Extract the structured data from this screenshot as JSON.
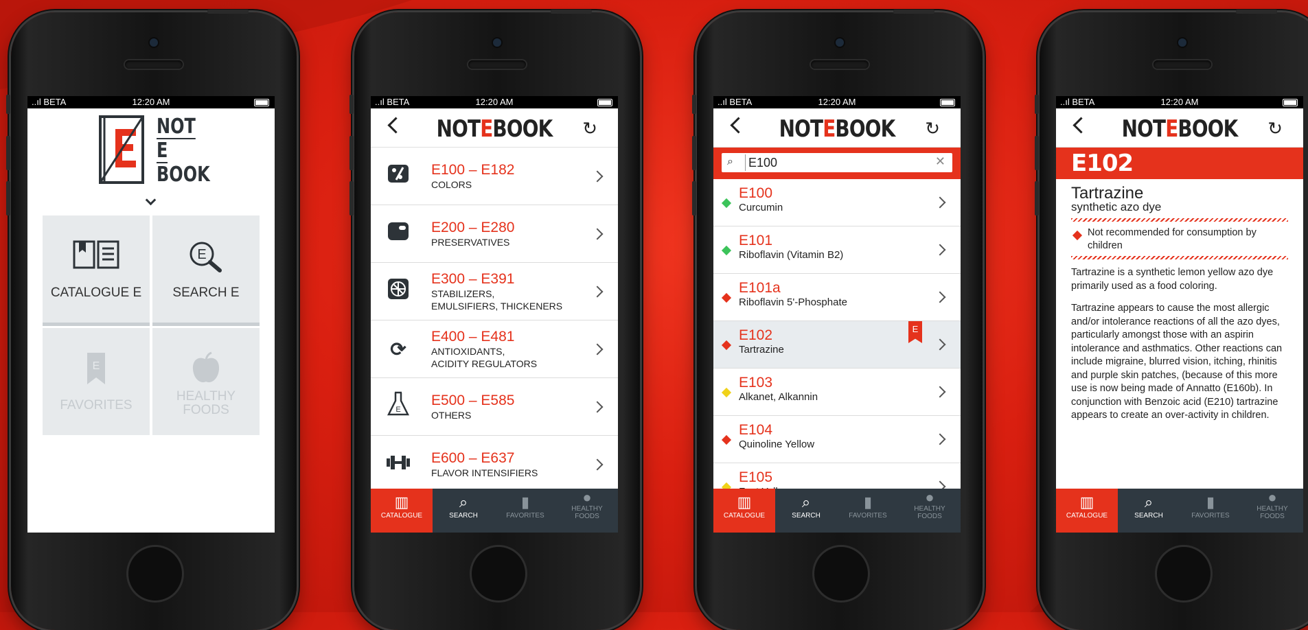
{
  "colors": {
    "accent": "#e5321c",
    "tabbar": "#2f3941",
    "safe": "#3cc35a",
    "caution": "#f0d21a",
    "danger": "#e5321c"
  },
  "status": {
    "signal": "..ıl BETA",
    "time": "12:20 AM"
  },
  "home": {
    "logo": {
      "line1": "NOT",
      "line2": "E",
      "line3": "BOOK",
      "letter": "E"
    },
    "tiles": [
      {
        "label": "CATALOGUE E",
        "icon": "catalogue-book-icon",
        "enabled": true
      },
      {
        "label": "SEARCH E",
        "icon": "search-e-icon",
        "enabled": true
      },
      {
        "label": "FAVORITES",
        "icon": "bookmark-icon",
        "enabled": false
      },
      {
        "label": "HEALTHY\nFOODS",
        "icon": "apple-icon",
        "enabled": false
      }
    ]
  },
  "navbar": {
    "title_pre": "NOT",
    "title_e": "E",
    "title_post": "BOOK",
    "back_icon": "chevron-left-icon",
    "refresh_icon": "refresh-icon"
  },
  "catalogue": {
    "rows": [
      {
        "range": "E100 – E182",
        "label": "COLORS",
        "icon": "palette-icon"
      },
      {
        "range": "E200 – E280",
        "label": "PRESERVATIVES",
        "icon": "can-icon"
      },
      {
        "range": "E300 – E391",
        "label": "STABILIZERS,\nEMULSIFIERS, THICKENERS",
        "icon": "fan-icon"
      },
      {
        "range": "E400 – E481",
        "label": "ANTIOXIDANTS,\nACIDITY REGULATORS",
        "icon": "cycle-icon"
      },
      {
        "range": "E500 – E585",
        "label": "OTHERS",
        "icon": "flask-icon"
      },
      {
        "range": "E600 – E637",
        "label": "FLAVOR INTENSIFIERS",
        "icon": "dumbbell-icon"
      }
    ]
  },
  "search": {
    "query": "E100",
    "results": [
      {
        "code": "E100",
        "name": "Curcumin",
        "status": "safe"
      },
      {
        "code": "E101",
        "name": "Riboflavin (Vitamin B2)",
        "status": "safe"
      },
      {
        "code": "E101a",
        "name": "Riboflavin 5'-Phosphate",
        "status": "danger"
      },
      {
        "code": "E102",
        "name": "Tartrazine",
        "status": "danger",
        "favorite": true,
        "selected": true
      },
      {
        "code": "E103",
        "name": "Alkanet, Alkannin",
        "status": "caution"
      },
      {
        "code": "E104",
        "name": "Quinoline Yellow",
        "status": "danger"
      },
      {
        "code": "E105",
        "name": "Fast Yellow",
        "status": "caution"
      }
    ]
  },
  "detail": {
    "code": "E102",
    "name": "Tartrazine",
    "type": "synthetic azo dye",
    "warning": "Not recommended for consumption by children",
    "para1": "Tartrazine is a synthetic lemon yellow azo dye primarily used as a food coloring.",
    "para2": "Tartrazine appears to cause the most allergic and/or intolerance reactions of all the azo dyes, particularly amongst those with an aspirin intolerance and asthmatics. Other reactions can include migraine, blurred vision, itching, rhinitis and purple skin patches, (because of this more use is now being made of Annatto (E160b). In conjunction with Benzoic acid (E210) tartrazine appears to create an over-activity in children."
  },
  "tabs": [
    {
      "label": "CATALOGUE",
      "icon": "catalogue-icon",
      "active": true,
      "enabled": true
    },
    {
      "label": "SEARCH",
      "icon": "search-icon",
      "active": false,
      "enabled": true
    },
    {
      "label": "FAVORITES",
      "icon": "bookmark-icon",
      "active": false,
      "enabled": false
    },
    {
      "label": "HEALTHY\nFOODS",
      "icon": "apple-icon",
      "active": false,
      "enabled": false
    }
  ]
}
